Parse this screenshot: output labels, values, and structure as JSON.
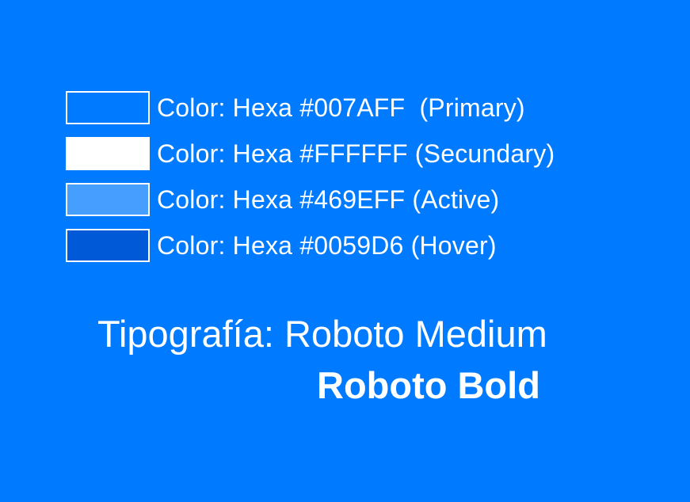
{
  "colors": [
    {
      "hex": "#007AFF",
      "label": "Color: Hexa #007AFF  (Primary)"
    },
    {
      "hex": "#FFFFFF",
      "label": "Color: Hexa #FFFFFF (Secundary)"
    },
    {
      "hex": "#469EFF",
      "label": "Color: Hexa #469EFF (Active)"
    },
    {
      "hex": "#0059D6",
      "label": "Color: Hexa #0059D6 (Hover)"
    }
  ],
  "typography": {
    "line1": "Tipografía: Roboto Medium",
    "line2": "Roboto Bold"
  },
  "background": "#007AFF"
}
